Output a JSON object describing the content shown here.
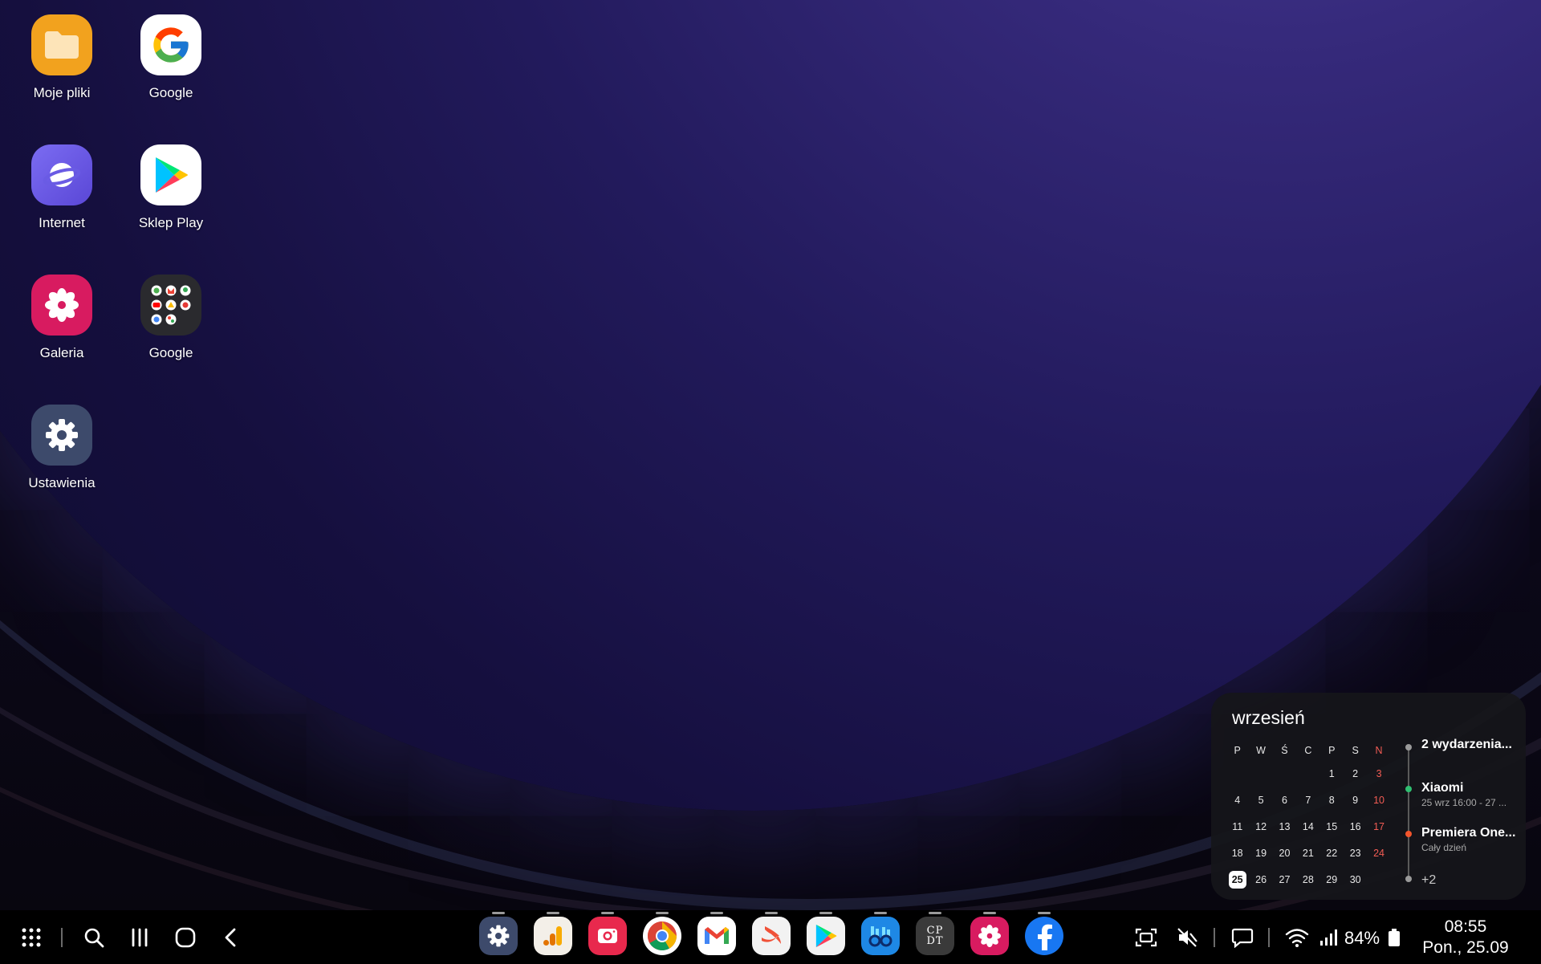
{
  "desktop": {
    "apps": [
      {
        "label": "Moje pliki",
        "icon": "folder-icon"
      },
      {
        "label": "Google",
        "icon": "google-g-icon"
      },
      {
        "label": "Internet",
        "icon": "samsung-internet-icon"
      },
      {
        "label": "Sklep Play",
        "icon": "play-store-icon"
      },
      {
        "label": "Galeria",
        "icon": "gallery-flower-icon"
      },
      {
        "label": "Google",
        "icon": "google-folder-icon"
      },
      {
        "label": "Ustawienia",
        "icon": "settings-gear-icon"
      }
    ]
  },
  "calendar": {
    "month": "wrzesień",
    "weekdays": [
      "P",
      "W",
      "Ś",
      "C",
      "P",
      "S",
      "N"
    ],
    "weeks": [
      [
        "",
        "",
        "",
        "",
        "1",
        "2",
        "3"
      ],
      [
        "4",
        "5",
        "6",
        "7",
        "8",
        "9",
        "10"
      ],
      [
        "11",
        "12",
        "13",
        "14",
        "15",
        "16",
        "17"
      ],
      [
        "18",
        "19",
        "20",
        "21",
        "22",
        "23",
        "24"
      ],
      [
        "25",
        "26",
        "27",
        "28",
        "29",
        "30",
        ""
      ]
    ],
    "today": "25",
    "events_header": "2 wydarzenia...",
    "events": [
      {
        "title": "Xiaomi",
        "subtitle": "25 wrz 16:00 - 27 ...",
        "color": "#2fbf71"
      },
      {
        "title": "Premiera One...",
        "subtitle": "Cały dzień",
        "color": "#f2552c"
      }
    ],
    "more": "+2",
    "colors": {
      "sunday": "#f25c54",
      "today_bg": "#ffffff"
    }
  },
  "taskbar": {
    "nav": [
      "apps-grid-icon",
      "search-icon",
      "recents-icon",
      "home-icon",
      "back-icon"
    ],
    "dock": [
      "settings-icon",
      "analytics-icon",
      "camera-icon",
      "chrome-icon",
      "gmail-icon",
      "swift-icon",
      "play-store-icon",
      "finder-glasses-icon",
      "cpdt-icon",
      "gallery-icon",
      "facebook-icon"
    ],
    "cpdt_label": "CP DT",
    "battery": "84%",
    "time": "08:55",
    "date": "Pon., 25.09"
  }
}
